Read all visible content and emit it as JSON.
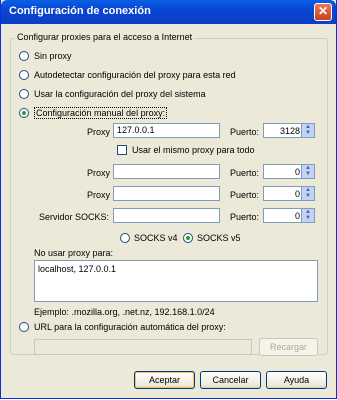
{
  "window": {
    "title": "Configuración de conexión"
  },
  "group_label": "Configurar proxies para el acceso a Internet",
  "options": {
    "no_proxy": "Sin proxy",
    "autodetect": "Autodetectar configuración del proxy para esta red",
    "system": "Usar la configuración del proxy del sistema",
    "manual": "Configuración manual del proxy:",
    "pac": "URL para la configuración automática del proxy:"
  },
  "manual": {
    "http_label": "Proxy HTTP:",
    "http_value": "127.0.0.1",
    "port_label": "Puerto:",
    "http_port": "3128",
    "same_proxy_label": "Usar el mismo proxy para todo",
    "ssl_label": "Proxy SSL:",
    "ssl_port": "0",
    "ftp_label": "Proxy FTP:",
    "ftp_port": "0",
    "socks_label": "Servidor SOCKS:",
    "socks_port": "0",
    "socks_v4": "SOCKS v4",
    "socks_v5": "SOCKS v5"
  },
  "no_proxy_for": {
    "label": "No usar proxy para:",
    "value": "localhost, 127.0.0.1",
    "example": "Ejemplo: .mozilla.org, .net.nz, 192.168.1.0/24"
  },
  "buttons": {
    "reload": "Recargar",
    "accept": "Aceptar",
    "cancel": "Cancelar",
    "help": "Ayuda"
  }
}
